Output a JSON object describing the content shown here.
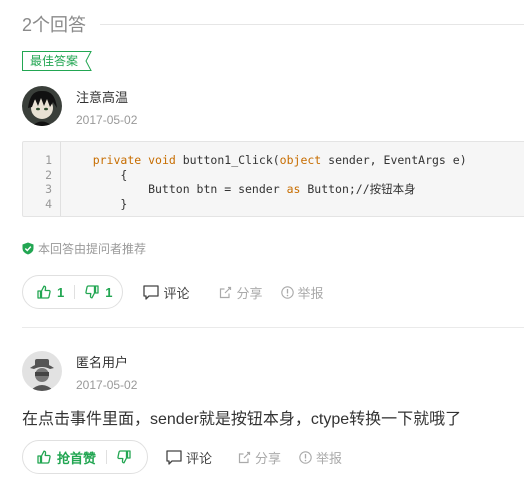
{
  "header": {
    "answer_count": "2个回答"
  },
  "best_answer": {
    "badge": "最佳答案",
    "user": {
      "name": "注意高温",
      "date": "2017-05-02",
      "avatar": "avatar-anime"
    },
    "code": {
      "line_numbers": [
        "1",
        "2",
        "3",
        "4"
      ],
      "line1": {
        "indent": "    ",
        "kw1": "private",
        "sp1": " ",
        "kw2": "void",
        "mid": " button1_Click(",
        "kw3": "object",
        "rest": " sender, EventArgs e)"
      },
      "line2": "        {",
      "line3": {
        "pre": "            Button btn = sender ",
        "kw": "as",
        "rest": " Button;//按钮本身"
      },
      "line4": "        }"
    },
    "recommended_note": "本回答由提问者推荐",
    "actions": {
      "upvotes": "1",
      "downvotes": "1",
      "comment": "评论",
      "share": "分享",
      "report": "举报"
    }
  },
  "second_answer": {
    "user": {
      "name": "匿名用户",
      "date": "2017-05-02",
      "avatar": "anonymous-avatar"
    },
    "text": "在点击事件里面，sender就是按钮本身，ctype转换一下就哦了",
    "actions": {
      "first_like": "抢首赞",
      "comment": "评论",
      "share": "分享",
      "report": "举报"
    }
  },
  "colors": {
    "accent_green": "#22a652",
    "muted": "#999999",
    "keyword": "#c76d00"
  }
}
